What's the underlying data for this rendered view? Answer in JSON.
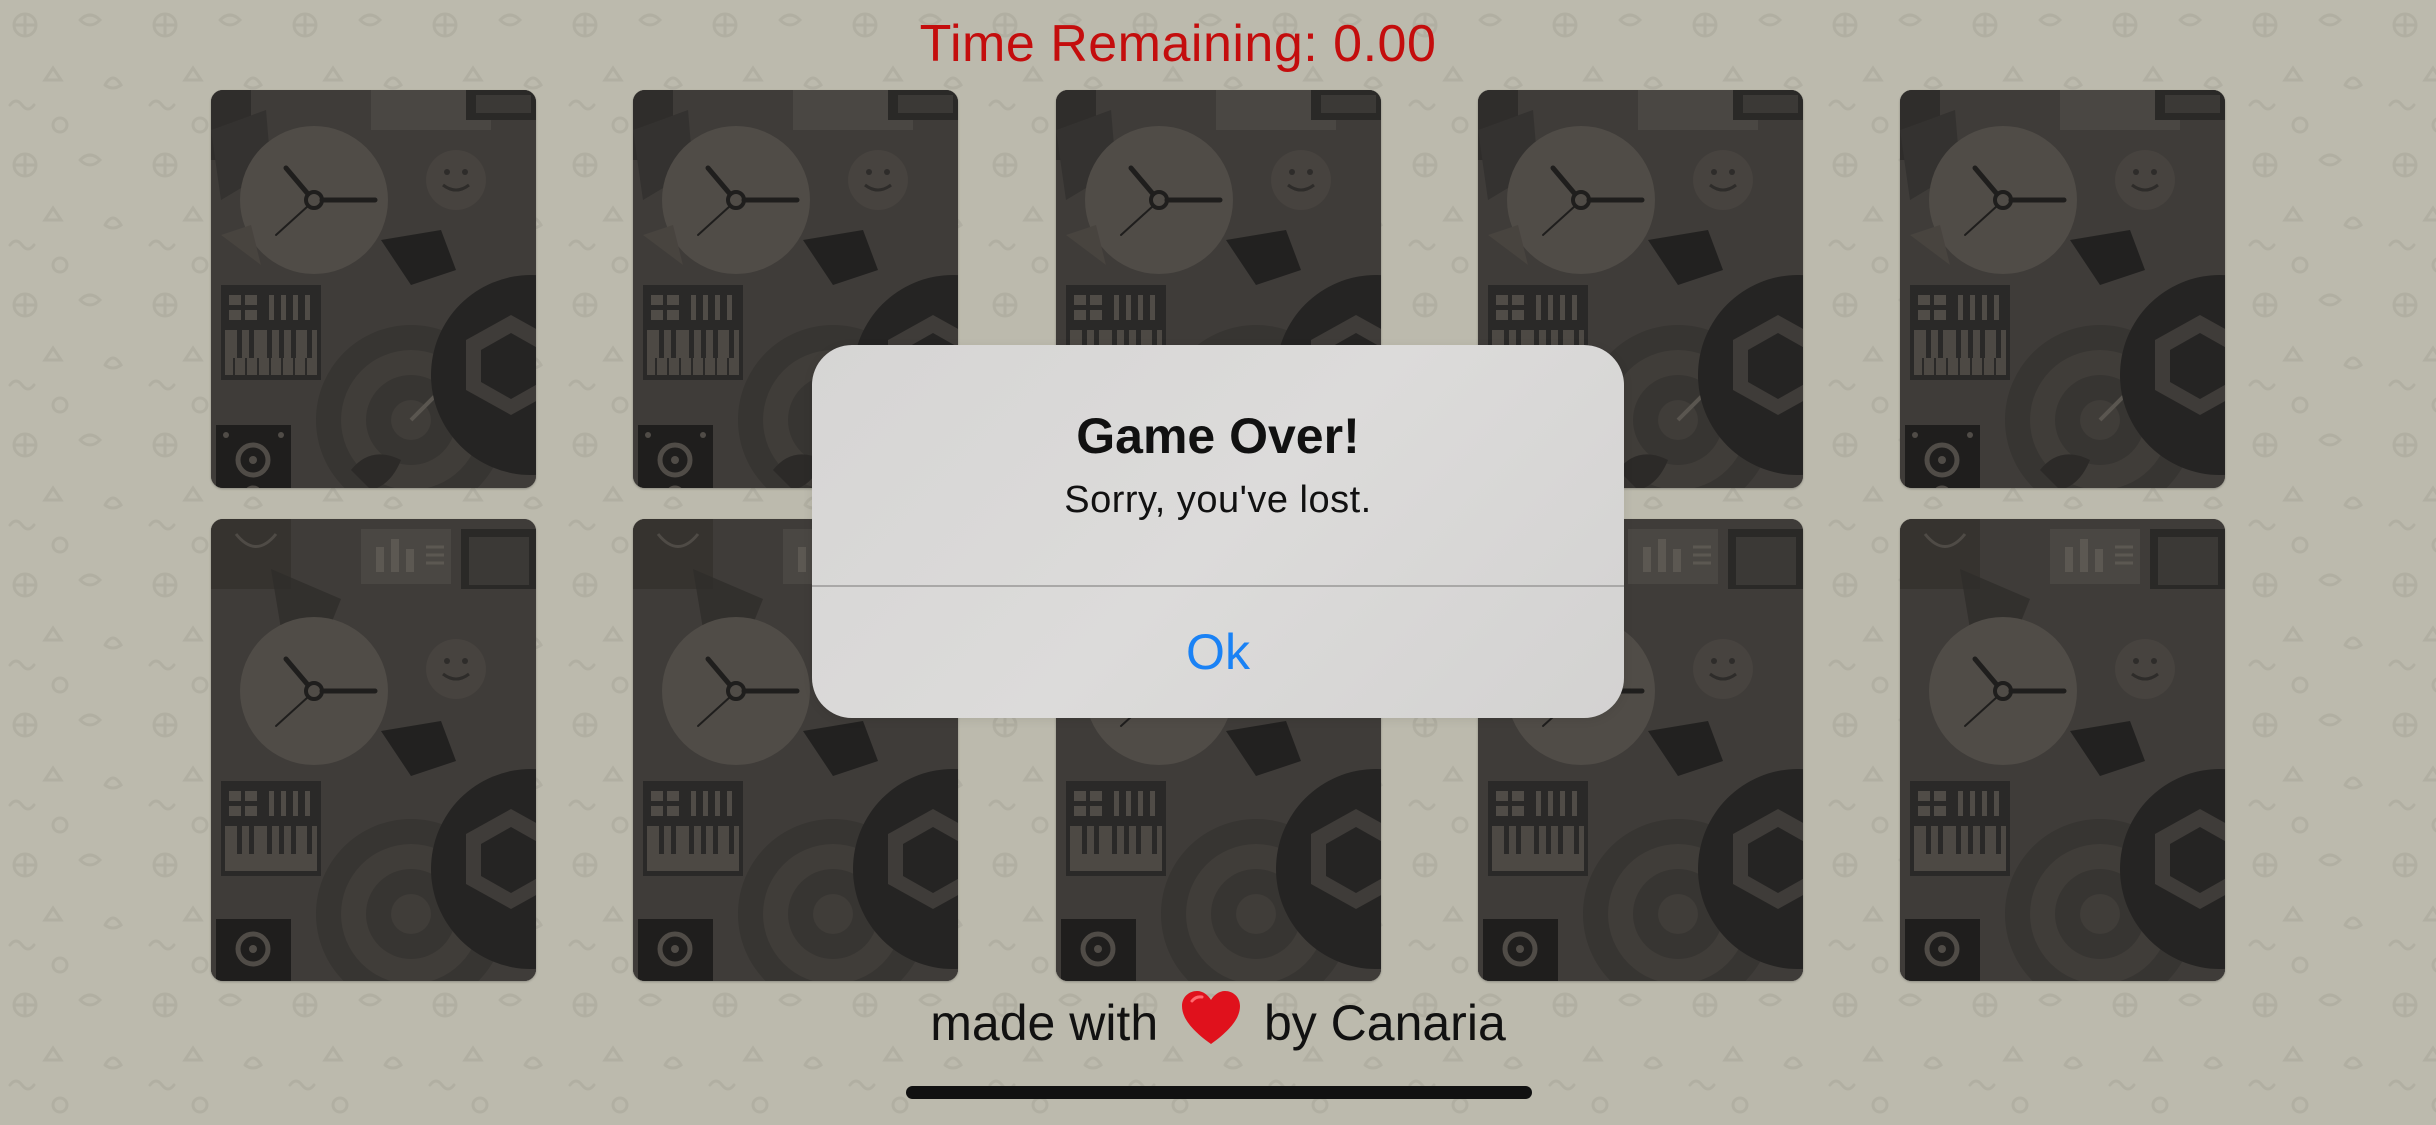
{
  "game": {
    "timer_text": "Time Remaining: 0.00",
    "card_back_icon": "card-back-pattern",
    "card_count": 10
  },
  "alert": {
    "title": "Game Over!",
    "message": "Sorry, you've lost.",
    "ok_label": "Ok"
  },
  "footer": {
    "prefix": "made with",
    "heart_icon": "heart-icon",
    "suffix": "by Canaria"
  },
  "colors": {
    "background": "#bcbaad",
    "timer": "#c40d0d",
    "card_back": "#3f3c39",
    "alert_button": "#1a82f5",
    "heart": "#e0111c"
  }
}
